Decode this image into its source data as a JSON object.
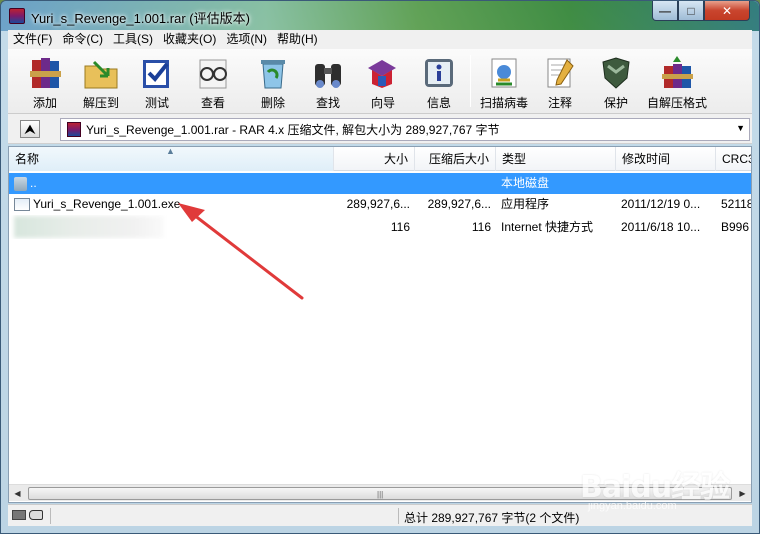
{
  "window": {
    "title": "Yuri_s_Revenge_1.001.rar (评估版本)",
    "controls": {
      "minimize": "—",
      "maximize": "□",
      "close": "✕"
    }
  },
  "menu": [
    "文件(F)",
    "命令(C)",
    "工具(S)",
    "收藏夹(O)",
    "选项(N)",
    "帮助(H)"
  ],
  "toolbar": {
    "add": "添加",
    "extract": "解压到",
    "test": "测试",
    "view": "查看",
    "delete": "删除",
    "find": "查找",
    "wizard": "向导",
    "info": "信息",
    "scan": "扫描病毒",
    "comment": "注释",
    "protect": "保护",
    "sfx": "自解压格式"
  },
  "address": {
    "up_glyph": "⮝",
    "path": "Yuri_s_Revenge_1.001.rar - RAR 4.x 压缩文件, 解包大小为 289,927,767 字节",
    "dropdown": "▼"
  },
  "columns": {
    "name": "名称",
    "size": "大小",
    "packed": "压缩后大小",
    "type": "类型",
    "modified": "修改时间",
    "crc": "CRC3"
  },
  "rows": [
    {
      "name": "..",
      "size": "",
      "packed": "",
      "type": "本地磁盘",
      "modified": "",
      "crc": ""
    },
    {
      "name": "Yuri_s_Revenge_1.001.exe",
      "size": "289,927,6...",
      "packed": "289,927,6...",
      "type": "应用程序",
      "modified": "2011/12/19 0...",
      "crc": "52118"
    },
    {
      "name": "",
      "size": "116",
      "packed": "116",
      "type": "Internet 快捷方式",
      "modified": "2011/6/18 10...",
      "crc": "B996"
    }
  ],
  "scroll": {
    "left": "◀",
    "right": "▶",
    "grip": "|||"
  },
  "status": {
    "summary": "总计 289,927,767 字节(2 个文件)"
  },
  "watermark": {
    "logo": "Baidu经验",
    "url": "jingyan.baidu.com"
  },
  "colors": {
    "selection": "#3399ff",
    "annotation": "#e03a3a"
  }
}
